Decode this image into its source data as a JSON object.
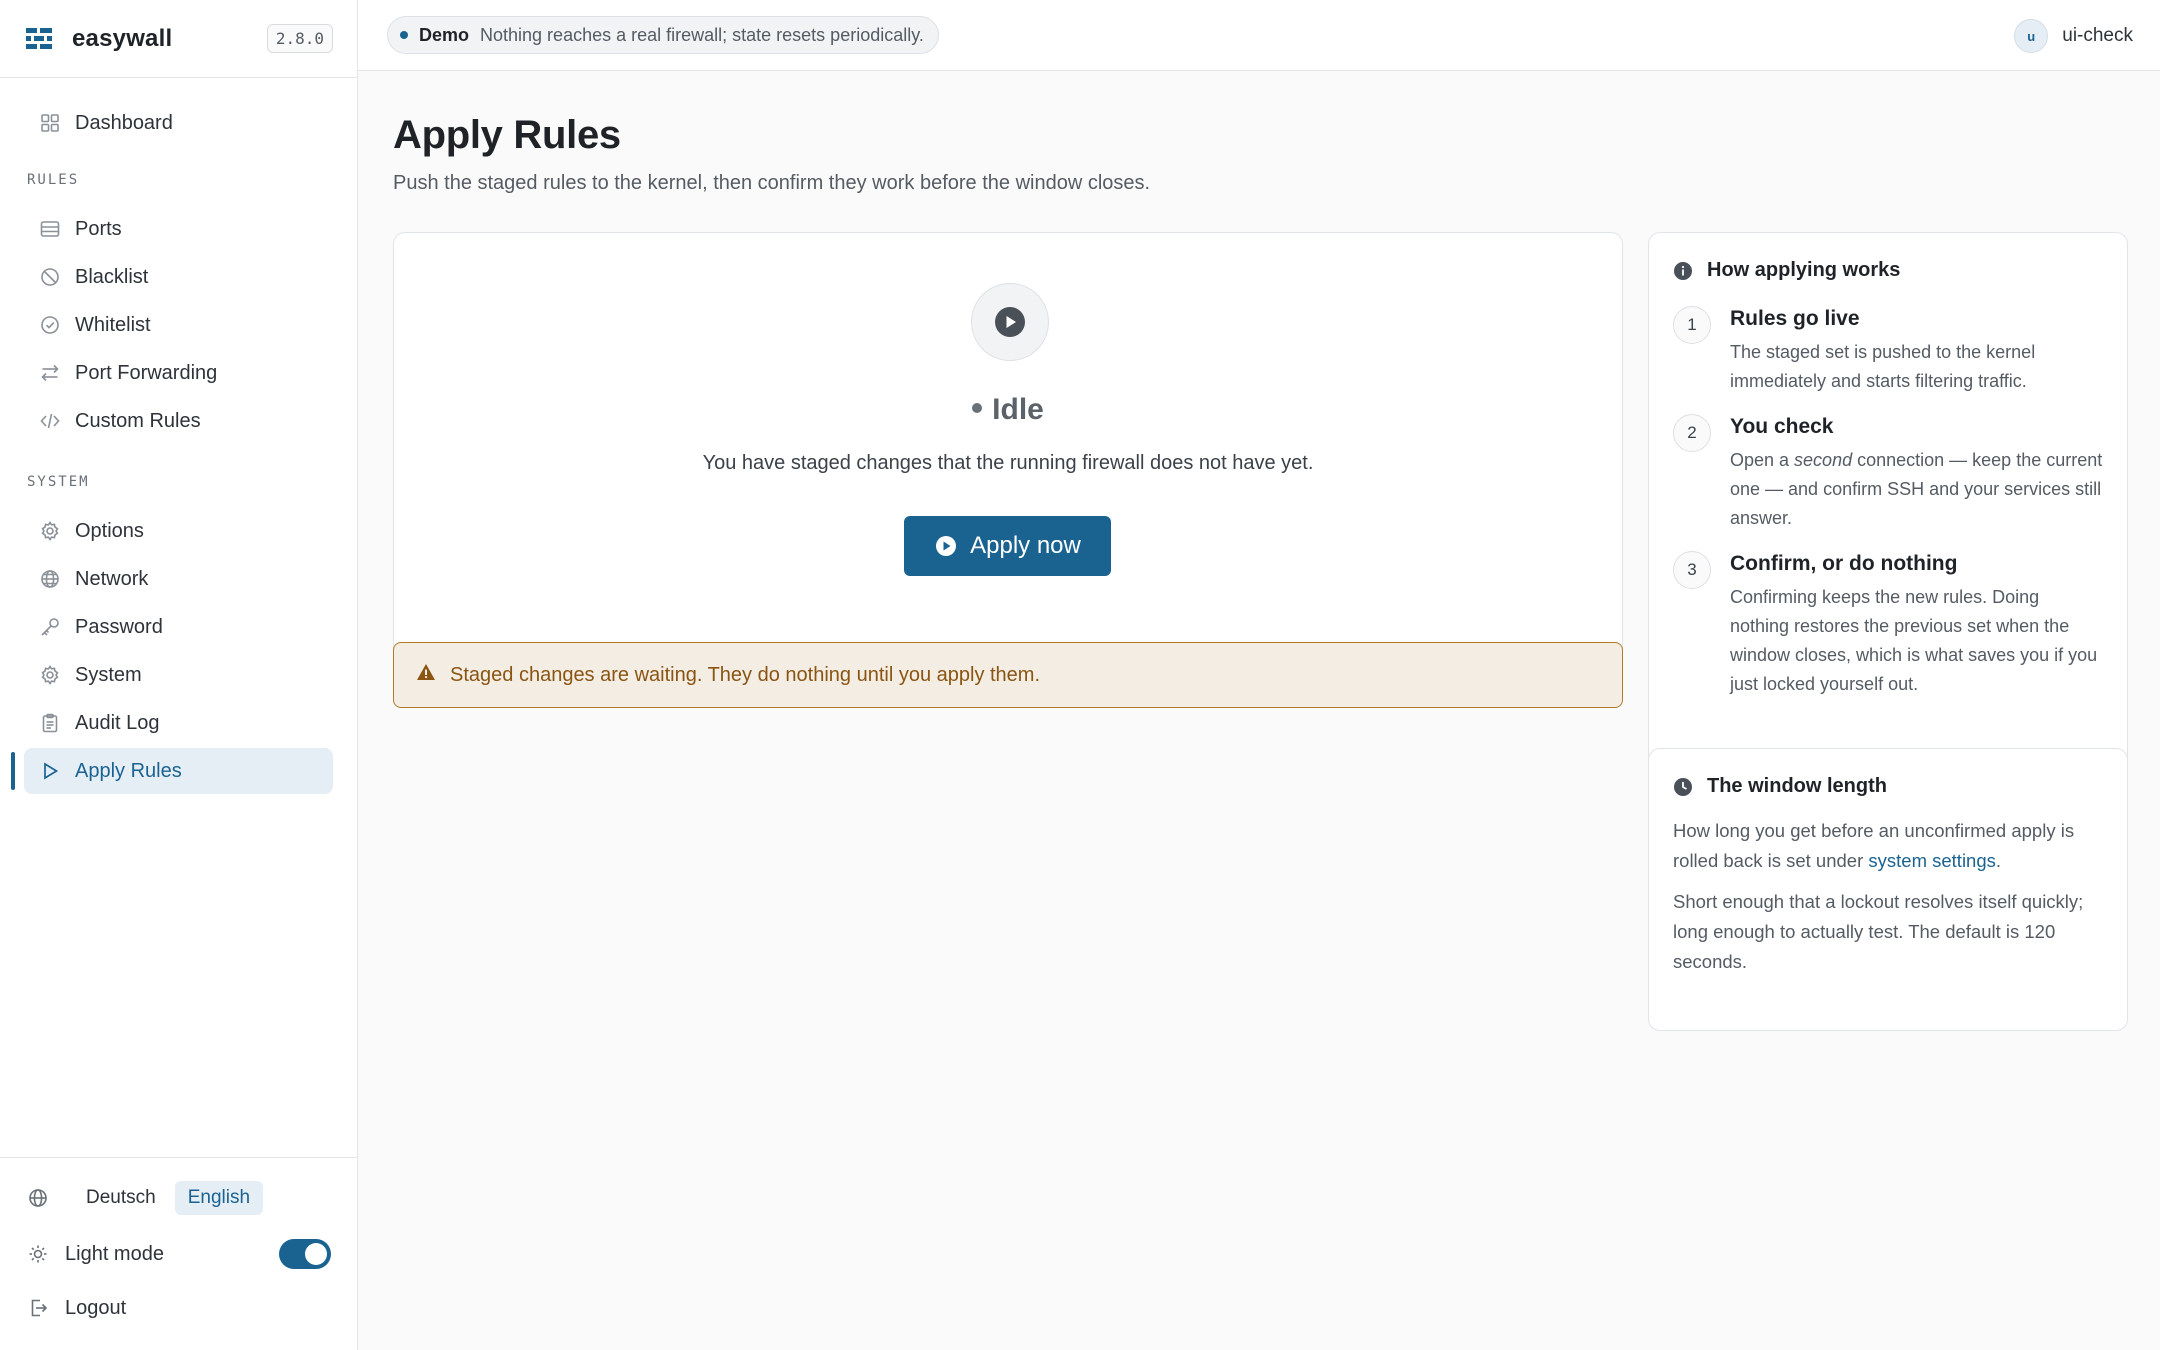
{
  "app": {
    "name": "easywall",
    "version": "2.8.0"
  },
  "nav": {
    "dashboard": "Dashboard",
    "sections": {
      "rules": "RULES",
      "system": "SYSTEM"
    },
    "rules_items": [
      "Ports",
      "Blacklist",
      "Whitelist",
      "Port Forwarding",
      "Custom Rules"
    ],
    "system_items": [
      "Options",
      "Network",
      "Password",
      "System",
      "Audit Log",
      "Apply Rules"
    ],
    "active": "Apply Rules"
  },
  "footer": {
    "languages": [
      "Deutsch",
      "English"
    ],
    "active_language": "English",
    "mode_label": "Light mode",
    "mode_on": true,
    "logout": "Logout"
  },
  "topbar": {
    "demo_label": "Demo",
    "demo_text": "Nothing reaches a real firewall; state resets periodically.",
    "avatar_initial": "u",
    "username": "ui-check"
  },
  "page": {
    "title": "Apply Rules",
    "subtitle": "Push the staged rules to the kernel, then confirm they work before the window closes."
  },
  "apply": {
    "status": "Idle",
    "description": "You have staged changes that the running firewall does not have yet.",
    "button": "Apply now",
    "warning": "Staged changes are waiting. They do nothing until you apply them."
  },
  "how": {
    "title": "How applying works",
    "steps": [
      {
        "num": "1",
        "title": "Rules go live",
        "text": "The staged set is pushed to the kernel immediately and starts filtering traffic."
      },
      {
        "num": "2",
        "title": "You check",
        "text_pre": "Open a ",
        "text_em": "second",
        "text_post": " connection — keep the current one — and confirm SSH and your services still answer."
      },
      {
        "num": "3",
        "title": "Confirm, or do nothing",
        "text": "Confirming keeps the new rules. Doing nothing restores the previous set when the window closes, which is what saves you if you just locked yourself out."
      }
    ]
  },
  "window": {
    "title": "The window length",
    "p1_pre": "How long you get before an unconfirmed apply is rolled back is set under ",
    "p1_link": "system settings",
    "p1_post": ".",
    "p2": "Short enough that a lockout resolves itself quickly; long enough to actually test. The default is 120 seconds."
  },
  "colors": {
    "accent": "#1a6391",
    "warning_border": "#b07a2a",
    "warning_bg": "#f3ede3"
  },
  "icons": {
    "brand": "easywall-logo-icon",
    "dashboard": "grid-icon",
    "ports": "server-icon",
    "blacklist": "ban-icon",
    "whitelist": "check-circle-icon",
    "port_forwarding": "arrows-icon",
    "custom_rules": "code-icon",
    "options": "gear-icon",
    "network": "globe-icon",
    "password": "key-icon",
    "system": "gear-icon",
    "audit_log": "clipboard-icon",
    "apply_rules": "play-icon"
  }
}
